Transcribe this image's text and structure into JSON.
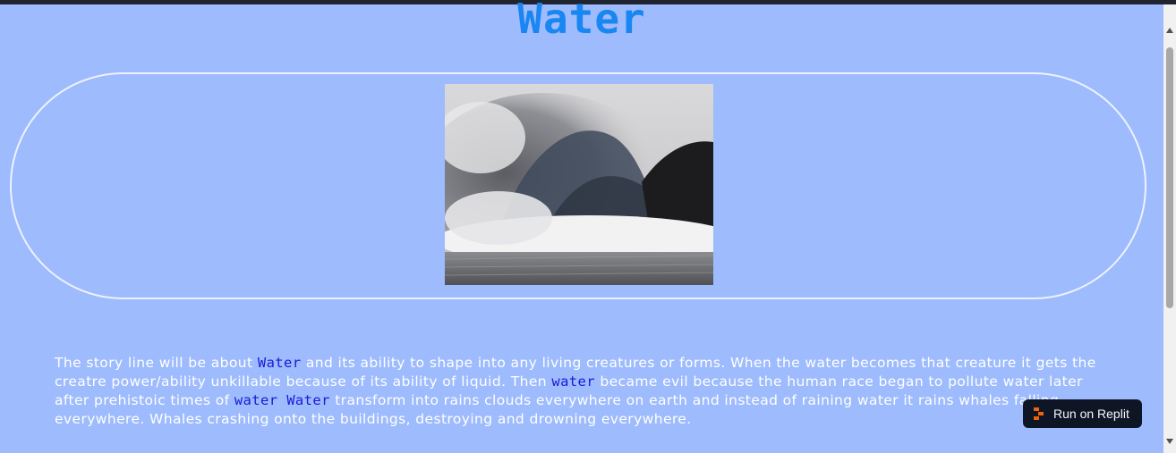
{
  "page": {
    "title": "Water"
  },
  "image": {
    "alt": "Water"
  },
  "story": {
    "part1": "The story line will be about ",
    "hl1": "Water",
    "part2": " and its ability to shape into any living creatures or forms. When the water becomes that creature it gets the creatre power/ability unkillable because of its ability of liquid. Then ",
    "hl2": "water",
    "part3": " became evil because the human race began to pollute water later after prehistoic times of ",
    "hl3": "water Water",
    "part4": " transform into rains clouds everywhere on earth and instead of raining water it rains whales falling everywhere. Whales crashing onto the buildings, destroying and drowning everywhere."
  },
  "replit": {
    "label": "Run on Replit",
    "accent": "#f26207"
  },
  "colors": {
    "background": "#9dbbfd",
    "title": "#1a86f2",
    "highlight": "#1a1ad6"
  }
}
